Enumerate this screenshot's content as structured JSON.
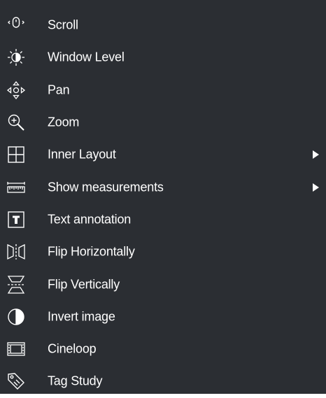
{
  "menu": {
    "items": [
      {
        "label": "Scroll",
        "icon": "mouse-scroll-icon",
        "has_submenu": false
      },
      {
        "label": "Window Level",
        "icon": "window-level-icon",
        "has_submenu": false
      },
      {
        "label": "Pan",
        "icon": "pan-icon",
        "has_submenu": false
      },
      {
        "label": "Zoom",
        "icon": "zoom-icon",
        "has_submenu": false
      },
      {
        "label": "Inner Layout",
        "icon": "grid-layout-icon",
        "has_submenu": true
      },
      {
        "label": "Show measurements",
        "icon": "ruler-icon",
        "has_submenu": true
      },
      {
        "label": "Text annotation",
        "icon": "text-annotation-icon",
        "has_submenu": false
      },
      {
        "label": "Flip Horizontally",
        "icon": "flip-horizontal-icon",
        "has_submenu": false
      },
      {
        "label": "Flip Vertically",
        "icon": "flip-vertical-icon",
        "has_submenu": false
      },
      {
        "label": "Invert image",
        "icon": "invert-icon",
        "has_submenu": false
      },
      {
        "label": "Cineloop",
        "icon": "film-icon",
        "has_submenu": false
      },
      {
        "label": "Tag Study",
        "icon": "tag-icon",
        "has_submenu": false
      }
    ]
  },
  "colors": {
    "background": "#2b2e33",
    "text": "#ffffff"
  }
}
